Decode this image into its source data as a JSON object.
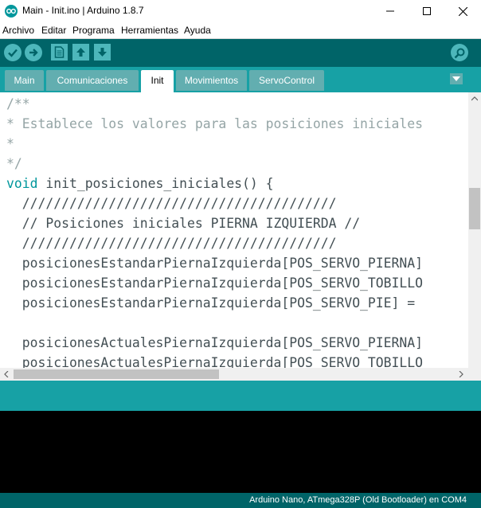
{
  "window": {
    "title": "Main - Init.ino | Arduino 1.8.7"
  },
  "menu": {
    "items": [
      "Archivo",
      "Editar",
      "Programa",
      "Herramientas",
      "Ayuda"
    ]
  },
  "toolbar": {
    "buttons": [
      "verify",
      "upload",
      "new",
      "open",
      "save",
      "serial-monitor"
    ]
  },
  "tabs": [
    {
      "label": "Main",
      "active": false
    },
    {
      "label": "Comunicaciones",
      "active": false
    },
    {
      "label": "Init",
      "active": true
    },
    {
      "label": "Movimientos",
      "active": false
    },
    {
      "label": "ServoControl",
      "active": false
    }
  ],
  "editor": {
    "lines": [
      {
        "kind": "comment",
        "text": "/**"
      },
      {
        "kind": "comment",
        "text": "* Establece los valores para las posiciones iniciales"
      },
      {
        "kind": "comment",
        "text": "*"
      },
      {
        "kind": "comment",
        "text": "*/"
      },
      {
        "kind": "func",
        "keyword": "void",
        "text": " init_posiciones_iniciales() {"
      },
      {
        "kind": "code",
        "text": "  ////////////////////////////////////////"
      },
      {
        "kind": "code",
        "text": "  // Posiciones iniciales PIERNA IZQUIERDA //"
      },
      {
        "kind": "code",
        "text": "  ////////////////////////////////////////"
      },
      {
        "kind": "code",
        "text": "  posicionesEstandarPiernaIzquierda[POS_SERVO_PIERNA]"
      },
      {
        "kind": "code",
        "text": "  posicionesEstandarPiernaIzquierda[POS_SERVO_TOBILLO"
      },
      {
        "kind": "code",
        "text": "  posicionesEstandarPiernaIzquierda[POS_SERVO_PIE] ="
      },
      {
        "kind": "code",
        "text": ""
      },
      {
        "kind": "code",
        "text": "  posicionesActualesPiernaIzquierda[POS_SERVO_PIERNA]"
      },
      {
        "kind": "code",
        "text": "  posicionesActualesPiernaIzquierda[POS_SERVO_TOBILLO"
      }
    ]
  },
  "footer": {
    "board": "Arduino Nano, ATmega328P (Old Bootloader) en COM4"
  },
  "colors": {
    "toolbar": "#006468",
    "tabbar": "#17a1a5",
    "tab_inactive": "#62aeb0",
    "button": "#4db7bb",
    "comment": "#95a5a6",
    "keyword": "#00979c",
    "code": "#434f54"
  }
}
